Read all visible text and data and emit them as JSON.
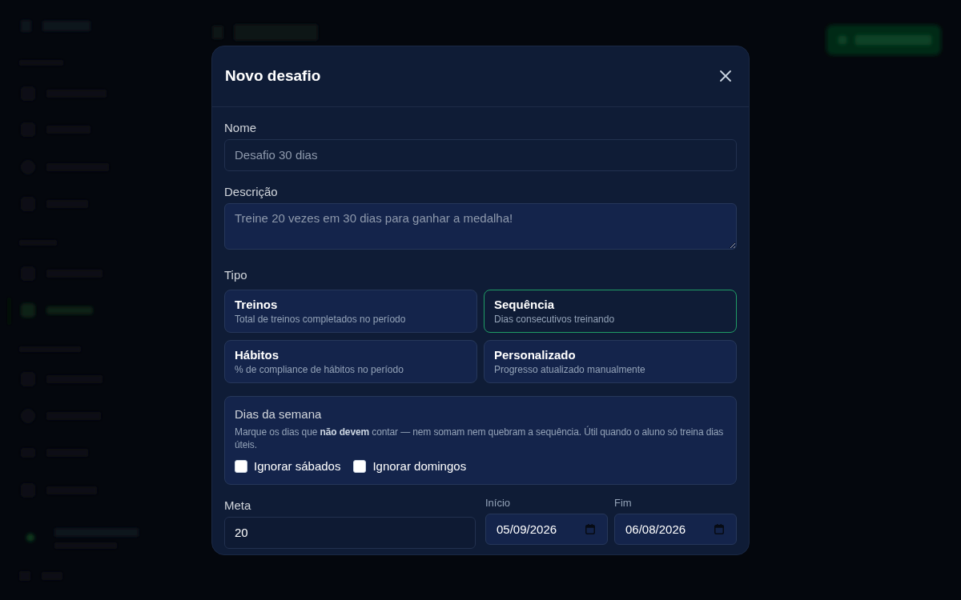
{
  "modal": {
    "title": "Novo desafio"
  },
  "name_field": {
    "label": "Nome",
    "placeholder": "Desafio 30 dias"
  },
  "description_field": {
    "label": "Descrição",
    "placeholder": "Treine 20 vezes em 30 dias para ganhar a medalha!"
  },
  "type": {
    "label": "Tipo",
    "options": [
      {
        "title": "Treinos",
        "description": "Total de treinos completados no período",
        "selected": false
      },
      {
        "title": "Sequência",
        "description": "Dias consecutivos treinando",
        "selected": true
      },
      {
        "title": "Hábitos",
        "description": "% de compliance de hábitos no período",
        "selected": false
      },
      {
        "title": "Personalizado",
        "description": "Progresso atualizado manualmente",
        "selected": false
      }
    ]
  },
  "weekdays": {
    "title": "Dias da semana",
    "hint": "Marque os dias que **não devem** contar — nem somam nem quebram a sequência. Útil quando o aluno só treina dias úteis.",
    "options": [
      {
        "label": "Ignorar sábados",
        "checked": false
      },
      {
        "label": "Ignorar domingos",
        "checked": false
      }
    ]
  },
  "goal": {
    "label": "Meta",
    "value": "20"
  },
  "dates": [
    {
      "label": "Início",
      "value": "05/09/2026"
    },
    {
      "label": "Fim",
      "value": "06/08/2026"
    }
  ]
}
